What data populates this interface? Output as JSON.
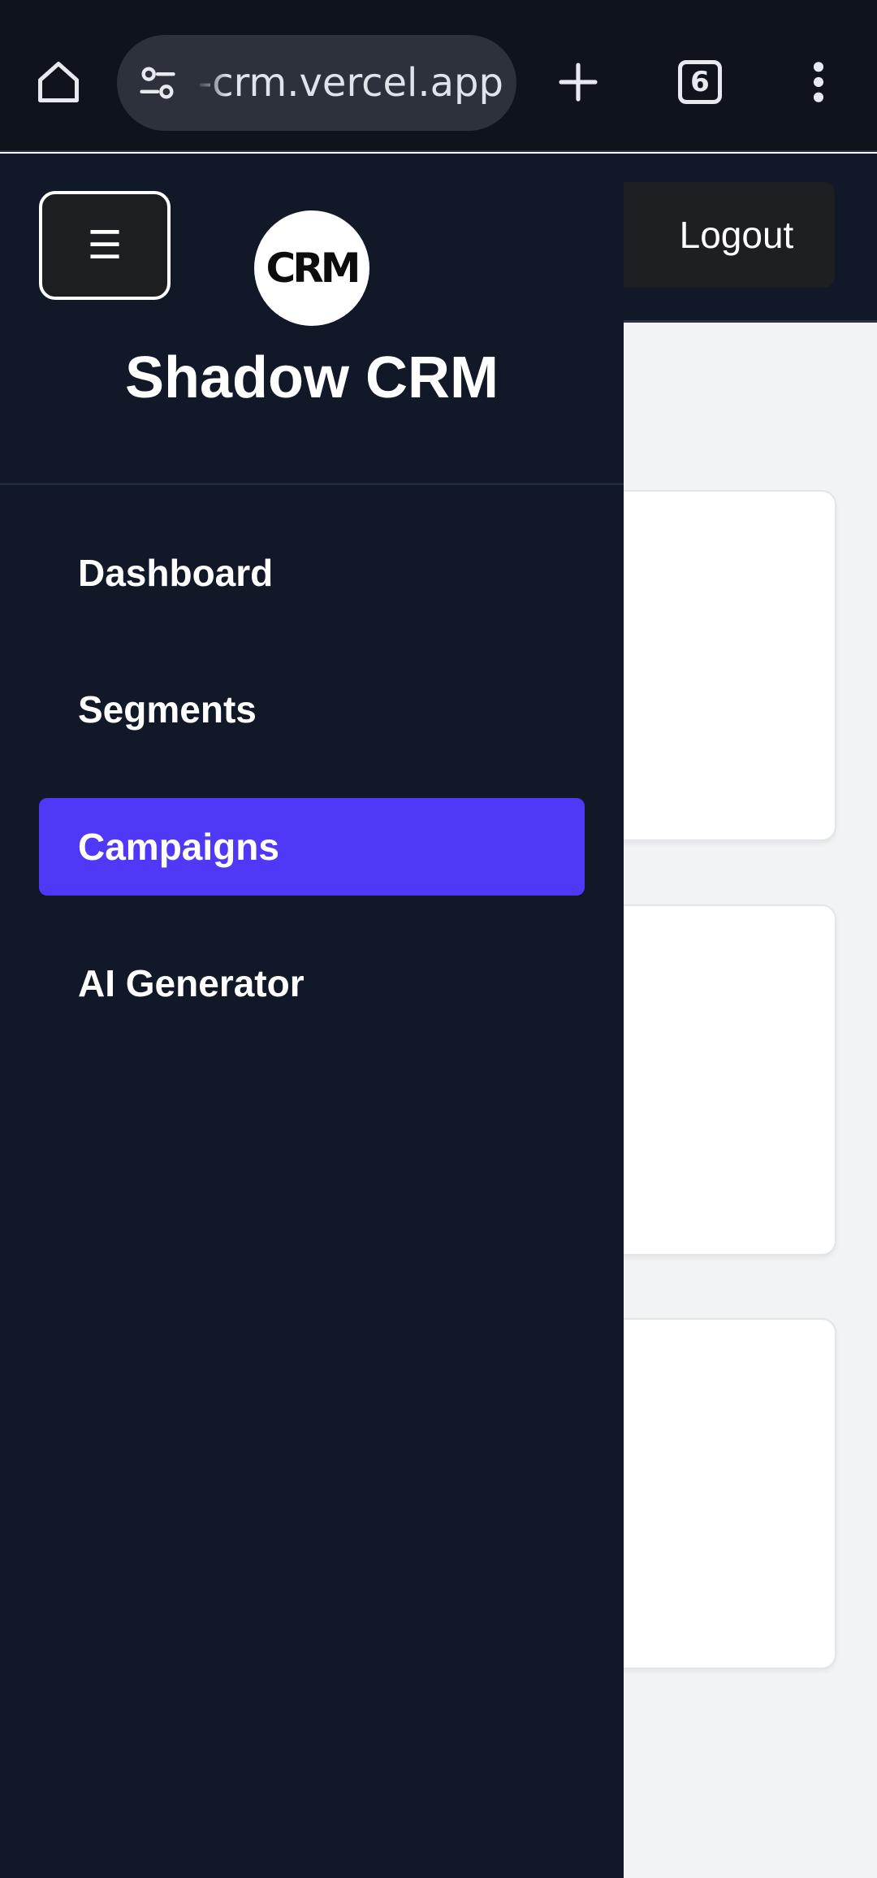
{
  "browser": {
    "url": "shadow-crm.vercel.app",
    "tab_count": "6",
    "icons": [
      "home-icon",
      "site-settings-icon",
      "plus-icon",
      "tab-switcher-icon",
      "more-vert-icon"
    ]
  },
  "header": {
    "logout_label": "Logout"
  },
  "sidebar": {
    "menu_icon": "☰",
    "logo_text": "CRM",
    "brand_title": "Shadow CRM",
    "items": [
      {
        "label": "Dashboard",
        "active": false
      },
      {
        "label": "Segments",
        "active": false
      },
      {
        "label": "Campaigns",
        "active": true
      },
      {
        "label": "AI Generator",
        "active": false
      }
    ]
  },
  "colors": {
    "browser_bg": "#0f131c",
    "app_bg": "#111827",
    "active_item": "#4f39f6",
    "content_bg": "#f2f3f5"
  }
}
